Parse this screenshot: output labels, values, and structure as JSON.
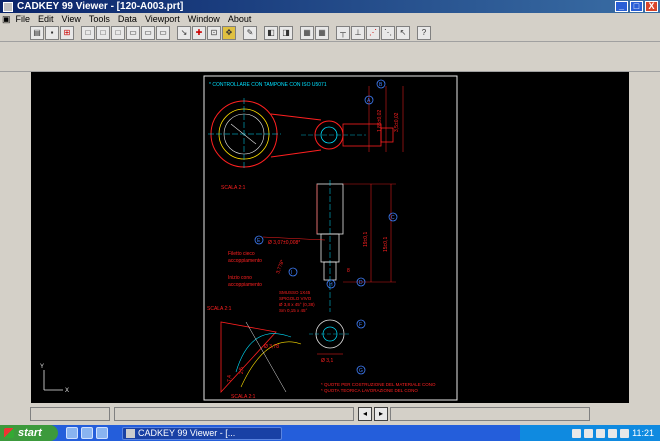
{
  "window": {
    "title": "CADKEY 99 Viewer - [120-A003.prt]",
    "buttons": {
      "minimize": "_",
      "maximize": "□",
      "close": "X"
    }
  },
  "menu": {
    "items": [
      "File",
      "Edit",
      "View",
      "Tools",
      "Data",
      "Viewport",
      "Window",
      "About"
    ]
  },
  "toolbar": {
    "group1": [
      "open-icon",
      "save-icon",
      "print-icon"
    ],
    "group2": [
      "view-top-icon",
      "view-front-icon",
      "view-side-icon",
      "view-iso-icon",
      "view-back-icon",
      "view-bottom-icon"
    ],
    "group3": [
      "zoom-in-icon",
      "zoom-window-icon",
      "zoom-all-icon",
      "pan-icon"
    ],
    "group4": [
      "redraw-icon"
    ],
    "group5": [
      "layer-icon",
      "level-icon",
      "color-icon",
      "style-icon"
    ],
    "group6": [
      "measure-icon",
      "dimension-icon",
      "grid-icon",
      "snap-icon",
      "cursor-icon"
    ],
    "help": "?"
  },
  "drawing": {
    "header_note": "* CONTROLLARE CON TAMPONE CON ISO U5071",
    "scale_top": "SCALA 2:1",
    "scale_left": "SCALA 2:1",
    "scale_bottom": "SCALA 2:1",
    "labels_left": [
      "Filetto cieco",
      "accoppiamento",
      "Inizio cono",
      "accoppiamento"
    ],
    "dims": [
      "Ø 3,07±0,008*",
      "19±0,1",
      "15±0,1",
      "3,778*",
      "Ø 3,78",
      "Ø 3,1",
      "7,4",
      "2,5",
      "8",
      "1,85±0,02",
      "3,5±0,02"
    ],
    "circle_letters": [
      "A",
      "B",
      "C",
      "D",
      "E",
      "F",
      "G",
      "H",
      "I"
    ],
    "notes_bottom": [
      "* QUOTE PER COSTRUZIONE DEL MATERIALE CONO",
      "* QUOTA TEORICA LAVORAZIONE DEL CONO"
    ],
    "small_notes": [
      "SMUSSO 1X45",
      "SPIGOLO VIVO",
      "Ø 3,8 x 45° (0,38)",
      "Sm 0,15 x 45°"
    ],
    "axis": {
      "x": "X",
      "y": "Y"
    }
  },
  "status": {
    "fields": [
      "",
      "",
      ""
    ],
    "nav_prev": "◂",
    "nav_next": "▸"
  },
  "taskbar": {
    "start": "start",
    "task": "CADKEY 99 Viewer - [...",
    "clock": "11:21"
  },
  "colors": {
    "drawing_red": "#ff2020",
    "drawing_cyan": "#00e0ff",
    "drawing_white": "#e8e8e8",
    "drawing_yellow": "#ffe000",
    "drawing_blue": "#4080ff"
  }
}
